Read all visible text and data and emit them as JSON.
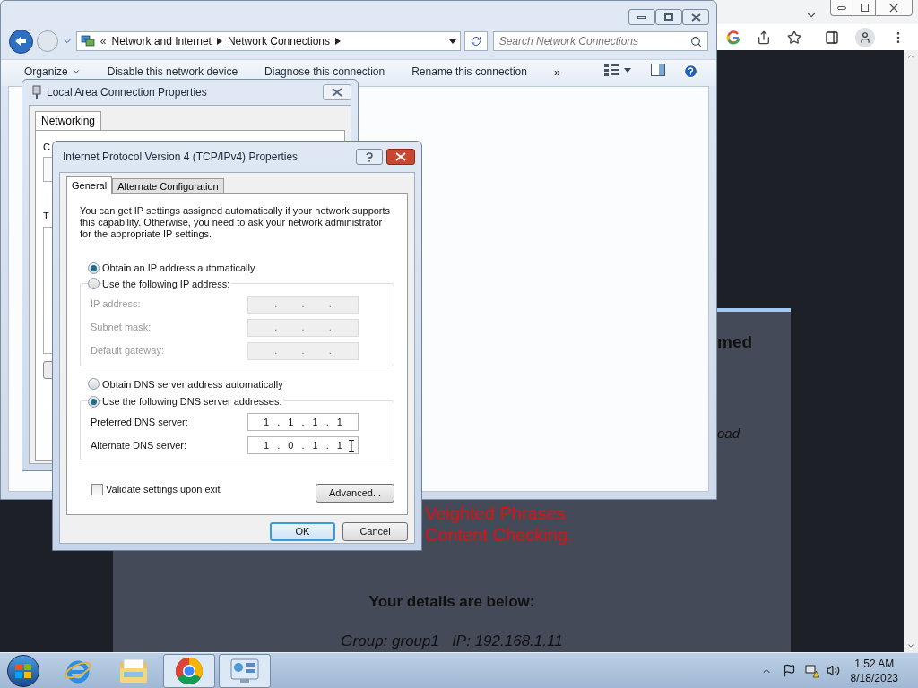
{
  "browser": {
    "page": {
      "heading_fragment": "med",
      "italic_fragment": "oad",
      "warning_lines": [
        "Veighted Phrases",
        "Content Checking."
      ],
      "details_heading": "Your details are below:",
      "details_line": "Group: group1   IP: 192.168.1.11"
    }
  },
  "explorer": {
    "breadcrumb_prefix": "«",
    "breadcrumb": [
      "Network and Internet",
      "Network Connections"
    ],
    "search": {
      "placeholder": "Search Network Connections"
    },
    "toolbar": [
      {
        "label": "Organize",
        "kind": "menu"
      },
      {
        "label": "Disable this network device",
        "kind": "command"
      },
      {
        "label": "Diagnose this connection",
        "kind": "command"
      },
      {
        "label": "Rename this connection",
        "kind": "command"
      }
    ],
    "overflow": "»"
  },
  "lan_dialog": {
    "title": "Local Area Connection Properties",
    "tabs": [
      {
        "label": "Networking",
        "selected": true
      }
    ],
    "fragments": [
      "C",
      "T"
    ]
  },
  "ipv4_dialog": {
    "title": "Internet Protocol Version 4 (TCP/IPv4) Properties",
    "tabs": [
      {
        "label": "General",
        "selected": true
      },
      {
        "label": "Alternate Configuration",
        "selected": false
      }
    ],
    "description": "You can get IP settings assigned automatically if your network supports this capability. Otherwise, you need to ask your network administrator for the appropriate IP settings.",
    "ip_mode": [
      {
        "label": "Obtain an IP address automatically",
        "selected": true
      },
      {
        "label": "Use the following IP address:",
        "selected": false
      }
    ],
    "ip_fields": [
      {
        "label": "IP address:",
        "value": ".   .   .",
        "disabled": true
      },
      {
        "label": "Subnet mask:",
        "value": ".   .   .",
        "disabled": true
      },
      {
        "label": "Default gateway:",
        "value": ".   .   .",
        "disabled": true
      }
    ],
    "dns_mode": [
      {
        "label": "Obtain DNS server address automatically",
        "selected": false
      },
      {
        "label": "Use the following DNS server addresses:",
        "selected": true
      }
    ],
    "dns_fields": [
      {
        "label": "Preferred DNS server:",
        "value": "1 . 1 . 1 . 1",
        "disabled": false
      },
      {
        "label": "Alternate DNS server:",
        "value": "1 . 0 . 1 . 1",
        "disabled": false
      }
    ],
    "validate": {
      "label": "Validate settings upon exit",
      "checked": false
    },
    "advanced_button": "Advanced...",
    "buttons": [
      {
        "label": "OK",
        "default": true
      },
      {
        "label": "Cancel",
        "default": false
      }
    ]
  },
  "taskbar": {
    "apps": [
      {
        "kind": "ie",
        "active": false
      },
      {
        "kind": "explorer",
        "active": false
      },
      {
        "kind": "chrome",
        "active": true
      },
      {
        "kind": "control-panel",
        "active": true
      }
    ],
    "time": "1:52 AM",
    "date": "8/18/2023"
  }
}
